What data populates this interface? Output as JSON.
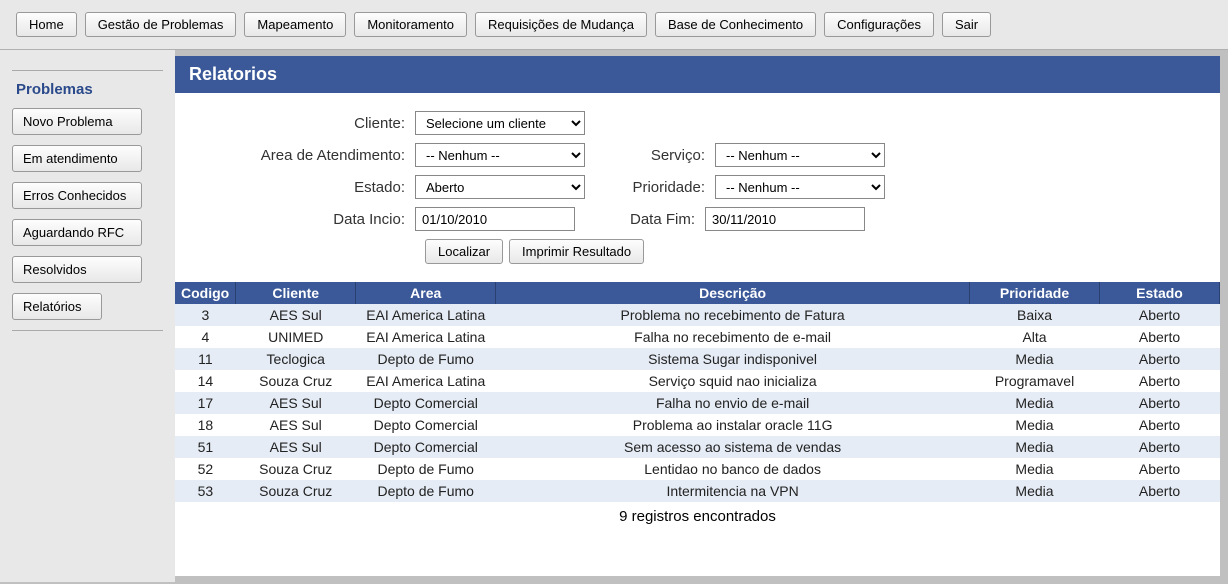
{
  "nav": {
    "home": "Home",
    "gestao": "Gestão de Problemas",
    "mapeamento": "Mapeamento",
    "monitoramento": "Monitoramento",
    "requisicoes": "Requisições de Mudança",
    "base": "Base de Conhecimento",
    "config": "Configurações",
    "sair": "Sair"
  },
  "sidebar": {
    "title": "Problemas",
    "novo": "Novo Problema",
    "atend": "Em atendimento",
    "erros": "Erros Conhecidos",
    "rfc": "Aguardando RFC",
    "resolvidos": "Resolvidos",
    "relatorios": "Relatórios"
  },
  "panel": {
    "title": "Relatorios"
  },
  "form": {
    "cliente_label": "Cliente:",
    "cliente_value": "Selecione um cliente",
    "area_label": "Area de Atendimento:",
    "area_value": "-- Nenhum --",
    "servico_label": "Serviço:",
    "servico_value": "-- Nenhum --",
    "estado_label": "Estado:",
    "estado_value": "Aberto",
    "prioridade_label": "Prioridade:",
    "prioridade_value": "-- Nenhum --",
    "inicio_label": "Data Incio:",
    "inicio_value": "01/10/2010",
    "fim_label": "Data Fim:",
    "fim_value": "30/11/2010",
    "localizar": "Localizar",
    "imprimir": "Imprimir Resultado"
  },
  "table": {
    "headers": {
      "codigo": "Codigo",
      "cliente": "Cliente",
      "area": "Area",
      "descricao": "Descrição",
      "prioridade": "Prioridade",
      "estado": "Estado"
    },
    "rows": [
      {
        "codigo": "3",
        "cliente": "AES Sul",
        "area": "EAI America Latina",
        "descricao": "Problema no recebimento de Fatura",
        "prioridade": "Baixa",
        "estado": "Aberto"
      },
      {
        "codigo": "4",
        "cliente": "UNIMED",
        "area": "EAI America Latina",
        "descricao": "Falha no recebimento de e-mail",
        "prioridade": "Alta",
        "estado": "Aberto"
      },
      {
        "codigo": "11",
        "cliente": "Teclogica",
        "area": "Depto de Fumo",
        "descricao": "Sistema Sugar indisponivel",
        "prioridade": "Media",
        "estado": "Aberto"
      },
      {
        "codigo": "14",
        "cliente": "Souza Cruz",
        "area": "EAI America Latina",
        "descricao": "Serviço squid nao inicializa",
        "prioridade": "Programavel",
        "estado": "Aberto"
      },
      {
        "codigo": "17",
        "cliente": "AES Sul",
        "area": "Depto Comercial",
        "descricao": "Falha no envio de e-mail",
        "prioridade": "Media",
        "estado": "Aberto"
      },
      {
        "codigo": "18",
        "cliente": "AES Sul",
        "area": "Depto Comercial",
        "descricao": "Problema ao instalar oracle 11G",
        "prioridade": "Media",
        "estado": "Aberto"
      },
      {
        "codigo": "51",
        "cliente": "AES Sul",
        "area": "Depto Comercial",
        "descricao": "Sem acesso ao sistema de vendas",
        "prioridade": "Media",
        "estado": "Aberto"
      },
      {
        "codigo": "52",
        "cliente": "Souza Cruz",
        "area": "Depto de Fumo",
        "descricao": "Lentidao no banco de dados",
        "prioridade": "Media",
        "estado": "Aberto"
      },
      {
        "codigo": "53",
        "cliente": "Souza Cruz",
        "area": "Depto de Fumo",
        "descricao": "Intermitencia na VPN",
        "prioridade": "Media",
        "estado": "Aberto"
      }
    ],
    "count": "9 registros encontrados"
  }
}
